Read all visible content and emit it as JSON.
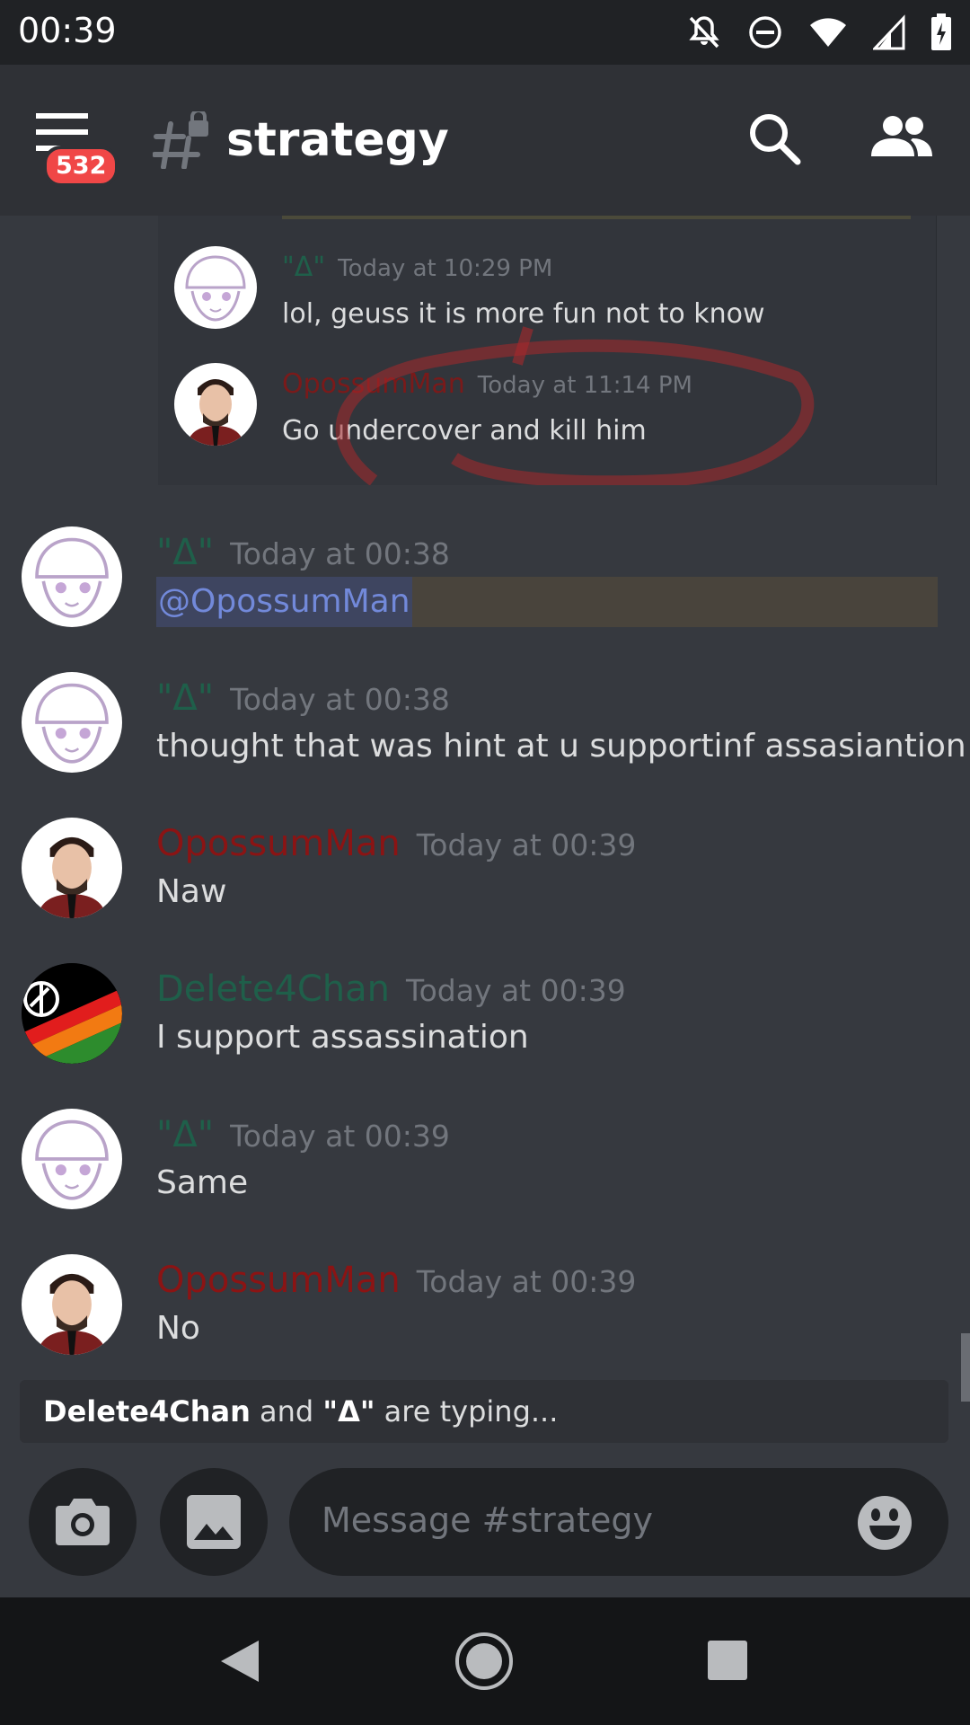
{
  "status_bar": {
    "time": "00:39"
  },
  "header": {
    "badge_count": "532",
    "channel_name": "strategy"
  },
  "quoted": [
    {
      "author": "\"Δ\"",
      "timestamp": "Today at 10:29 PM",
      "text": "lol, geuss it is more fun not to know",
      "name_color": "#1f5f4a"
    },
    {
      "author": "OpossumMan",
      "timestamp": "Today at 11:14 PM",
      "text": "Go undercover and kill him",
      "name_color": "#7a1a1a"
    }
  ],
  "messages": [
    {
      "author": "\"Δ\"",
      "timestamp": "Today at 00:38",
      "mention": "@OpossumMan",
      "name_color": "#1f5f4a"
    },
    {
      "author": "\"Δ\"",
      "timestamp": "Today at 00:38",
      "text": "thought that was hint at u supportinf assasiantion",
      "name_color": "#1f5f4a"
    },
    {
      "author": "OpossumMan",
      "timestamp": "Today at 00:39",
      "text": "Naw",
      "name_color": "#8b1414"
    },
    {
      "author": "Delete4Chan",
      "timestamp": "Today at 00:39",
      "text": "I support assassination",
      "name_color": "#1f5f4a"
    },
    {
      "author": "\"Δ\"",
      "timestamp": "Today at 00:39",
      "text": "Same",
      "name_color": "#1f5f4a"
    },
    {
      "author": "OpossumMan",
      "timestamp": "Today at 00:39",
      "text": "No",
      "name_color": "#8b1414"
    }
  ],
  "typing": {
    "user1": "Delete4Chan",
    "joiner": " and ",
    "user2": "\"Δ\"",
    "suffix": " are typing..."
  },
  "input": {
    "placeholder": "Message #strategy"
  },
  "icons": {
    "menu": "hamburger-menu-icon",
    "channel": "locked-hash-icon",
    "search": "search-icon",
    "members": "members-icon",
    "camera": "camera-icon",
    "gallery": "image-icon",
    "emoji": "emoji-icon"
  }
}
